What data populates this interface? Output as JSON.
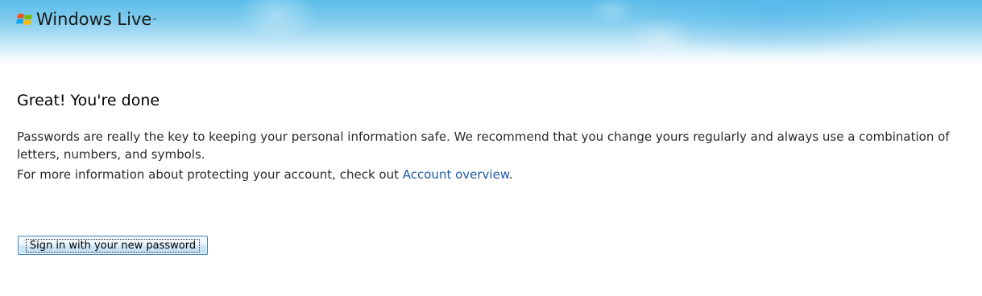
{
  "header": {
    "brand": "Windows Live",
    "trademark": "™",
    "logo_icon": "windows-flag-icon"
  },
  "content": {
    "heading": "Great!  You're done",
    "paragraph1": "Passwords are really the key to keeping your personal information safe.  We recommend that you change yours regularly and always use a combination of letters, numbers, and symbols.",
    "paragraph2_prefix": "For more information about protecting your account, check out ",
    "paragraph2_link": "Account overview",
    "paragraph2_suffix": "."
  },
  "actions": {
    "signin_label": "Sign in with your new password"
  },
  "colors": {
    "link": "#1e5aa8",
    "header_sky": "#5cbde9",
    "button_border": "#3c7fb1"
  }
}
